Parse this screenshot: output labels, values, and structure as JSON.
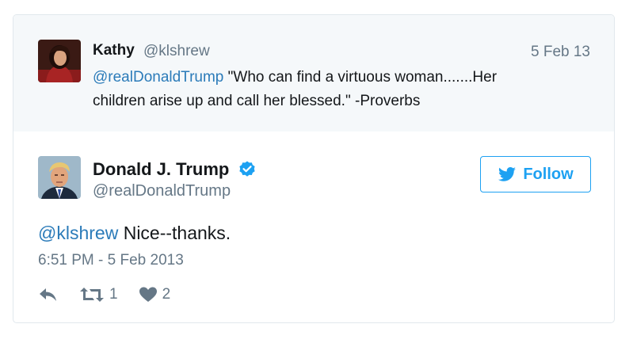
{
  "parent_tweet": {
    "author_name": "Kathy",
    "author_handle": "@klshrew",
    "date": "5 Feb 13",
    "mention": "@realDonaldTrump",
    "text_line1": " \"Who can find a virtuous woman.......Her",
    "text_line2": "children arise up and call her blessed.\" -Proverbs"
  },
  "main_tweet": {
    "author_name": "Donald J. Trump",
    "author_handle": "@realDonaldTrump",
    "verified_icon": "verified-badge-icon",
    "follow_label": "Follow",
    "mention": "@klshrew",
    "text": " Nice--thanks.",
    "timestamp": "6:51 PM - 5 Feb 2013",
    "retweet_count": "1",
    "like_count": "2"
  },
  "colors": {
    "accent": "#1da1f2",
    "mention": "#2b7bb9",
    "muted": "#657786",
    "parent_bg": "#f5f8fa"
  }
}
